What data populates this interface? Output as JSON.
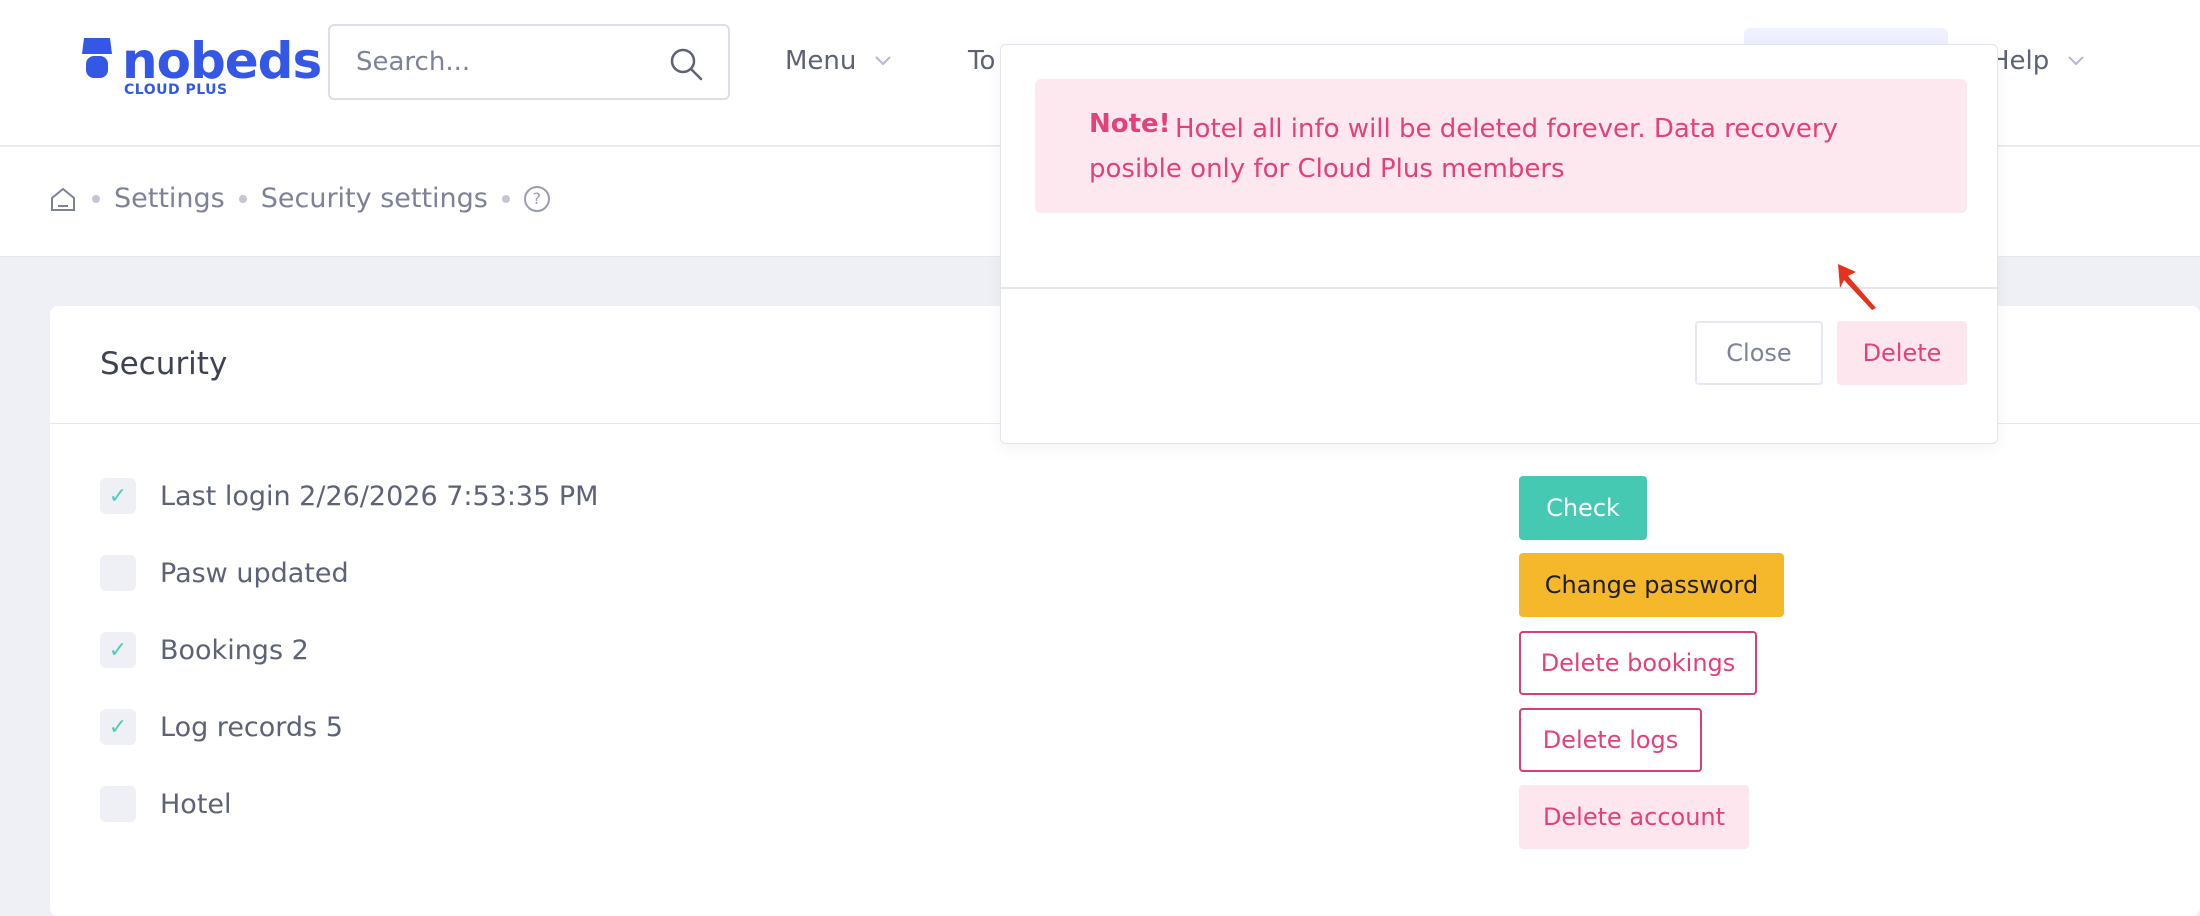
{
  "header": {
    "logo": {
      "word": "nobeds",
      "sub": "CLOUD PLUS"
    },
    "search": {
      "placeholder": "Search..."
    },
    "nav": {
      "menu": "Menu",
      "to": "To",
      "help": "Help"
    }
  },
  "breadcrumb": {
    "items": [
      "Settings",
      "Security settings"
    ],
    "help": "?"
  },
  "card": {
    "title": "Security",
    "rows": [
      {
        "label": "Last login 2/26/2026 7:53:35 PM",
        "checked": true
      },
      {
        "label": "Pasw updated",
        "checked": false
      },
      {
        "label": "Bookings 2",
        "checked": true
      },
      {
        "label": "Log records 5",
        "checked": true
      },
      {
        "label": "Hotel",
        "checked": false
      }
    ],
    "buttons": {
      "check": "Check",
      "change_password": "Change password",
      "delete_bookings": "Delete bookings",
      "delete_logs": "Delete logs",
      "delete_account": "Delete account"
    }
  },
  "modal": {
    "note_label": "Note!",
    "note_text": "Hotel all info will be deleted forever. Data recovery posible only for Cloud Plus members",
    "close": "Close",
    "delete": "Delete"
  },
  "colors": {
    "brand": "#3557e6",
    "teal": "#45c9b2",
    "amber": "#f5b82a",
    "danger": "#e4407a",
    "danger_bg": "#fde6ee"
  }
}
